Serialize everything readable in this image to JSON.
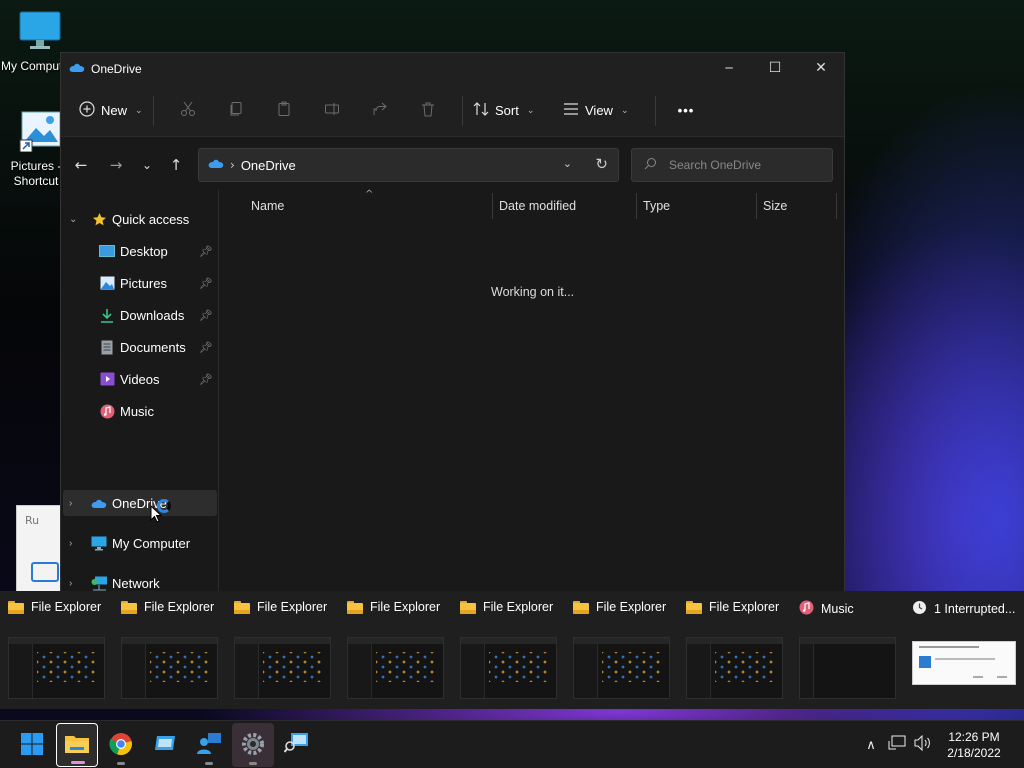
{
  "desktop": {
    "icons": [
      {
        "label": "My Computer",
        "icon": "monitor-icon"
      },
      {
        "label": "Pictures - Shortcut",
        "icon": "pictures-icon"
      }
    ],
    "run_dialog_peek": "Ru"
  },
  "window": {
    "title": "OneDrive",
    "controls": {
      "minimize": "─",
      "maximize": "☐",
      "close": "✕"
    }
  },
  "toolbar": {
    "new_label": "New",
    "sort_label": "Sort",
    "view_label": "View",
    "more_label": "•••"
  },
  "address": {
    "crumb": "OneDrive",
    "search_placeholder": "Search OneDrive"
  },
  "sidebar": {
    "quick_access": "Quick access",
    "items": [
      {
        "label": "Desktop",
        "icon": "desktop-icon",
        "pinned": true
      },
      {
        "label": "Pictures",
        "icon": "pictures-icon",
        "pinned": true
      },
      {
        "label": "Downloads",
        "icon": "downloads-icon",
        "pinned": true
      },
      {
        "label": "Documents",
        "icon": "documents-icon",
        "pinned": true
      },
      {
        "label": "Videos",
        "icon": "videos-icon",
        "pinned": true
      },
      {
        "label": "Music",
        "icon": "music-icon",
        "pinned": false
      }
    ],
    "onedrive": "OneDrive",
    "my_computer": "My Computer",
    "network": "Network"
  },
  "content": {
    "columns": [
      "Name",
      "Date modified",
      "Type",
      "Size"
    ],
    "status": "Working on it..."
  },
  "switcher": {
    "items": [
      {
        "label": "File Explorer",
        "icon": "folder-icon"
      },
      {
        "label": "File Explorer",
        "icon": "folder-icon"
      },
      {
        "label": "File Explorer",
        "icon": "folder-icon"
      },
      {
        "label": "File Explorer",
        "icon": "folder-icon"
      },
      {
        "label": "File Explorer",
        "icon": "folder-icon"
      },
      {
        "label": "File Explorer",
        "icon": "folder-icon"
      },
      {
        "label": "File Explorer",
        "icon": "folder-icon"
      },
      {
        "label": "Music",
        "icon": "music-icon"
      },
      {
        "label": "1 Interrupted...",
        "icon": "clock-icon"
      }
    ]
  },
  "taskbar": {
    "apps": [
      "start-icon",
      "file-explorer-icon",
      "chrome-icon",
      "remote-desktop-icon",
      "people-icon",
      "settings-icon",
      "network-search-icon"
    ],
    "time": "12:26 PM",
    "date": "2/18/2022"
  },
  "colors": {
    "accent": "#2f86e0",
    "window_bg": "#191919",
    "toolbar_bg": "#202020"
  }
}
